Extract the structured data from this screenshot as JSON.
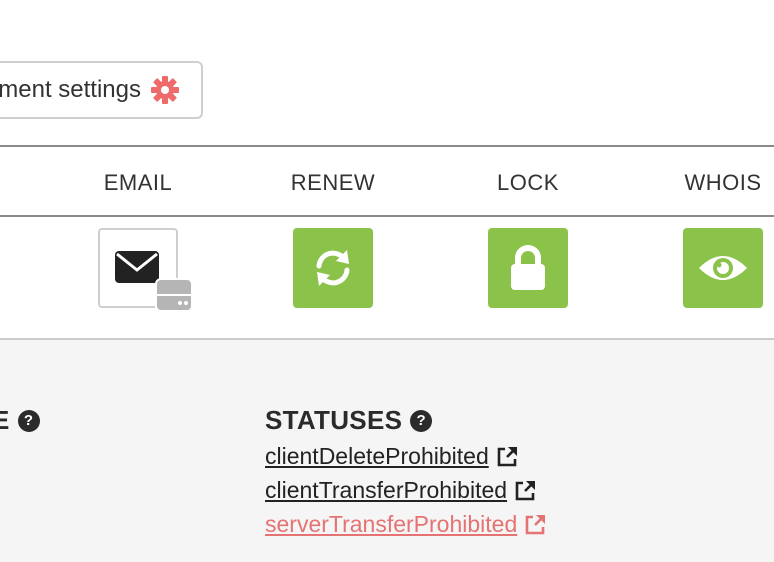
{
  "toolbar": {
    "management_settings_label": "ment settings"
  },
  "columns": {
    "email": "EMAIL",
    "renew": "RENEW",
    "lock": "LOCK",
    "whois": "WHOIS"
  },
  "left_section": {
    "title": "E"
  },
  "statuses": {
    "title": "STATUSES",
    "items": [
      {
        "label": "clientDeleteProhibited"
      },
      {
        "label": "clientTransferProhibited"
      },
      {
        "label": "serverTransferProhibited"
      }
    ]
  },
  "colors": {
    "green_action": "#8bc34a",
    "accent_red": "#e57373",
    "link_dark": "#222222",
    "panel_bg": "#f5f5f5"
  },
  "icons": [
    "gear-icon",
    "envelope-icon",
    "server-icon",
    "refresh-icon",
    "lock-icon",
    "eye-icon",
    "help-icon",
    "external-link-icon"
  ]
}
